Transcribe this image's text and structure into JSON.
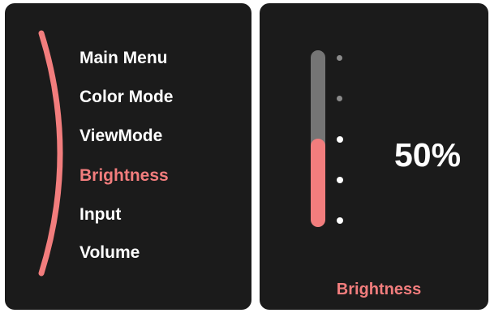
{
  "menu": {
    "items": [
      {
        "label": "Main Menu",
        "active": false
      },
      {
        "label": "Color Mode",
        "active": false
      },
      {
        "label": "ViewMode",
        "active": false
      },
      {
        "label": "Brightness",
        "active": true
      },
      {
        "label": "Input",
        "active": false
      },
      {
        "label": "Volume",
        "active": false
      }
    ]
  },
  "setting": {
    "name": "Brightness",
    "value_label": "50%",
    "level_fraction": 0.5,
    "step_count": 5
  },
  "colors": {
    "accent": "#f27d7d",
    "panel_background": "#1b1b1b",
    "track_inactive": "#757575",
    "dot_active": "#ffffff",
    "dot_inactive": "#8a8a8a",
    "text": "#ffffff"
  }
}
